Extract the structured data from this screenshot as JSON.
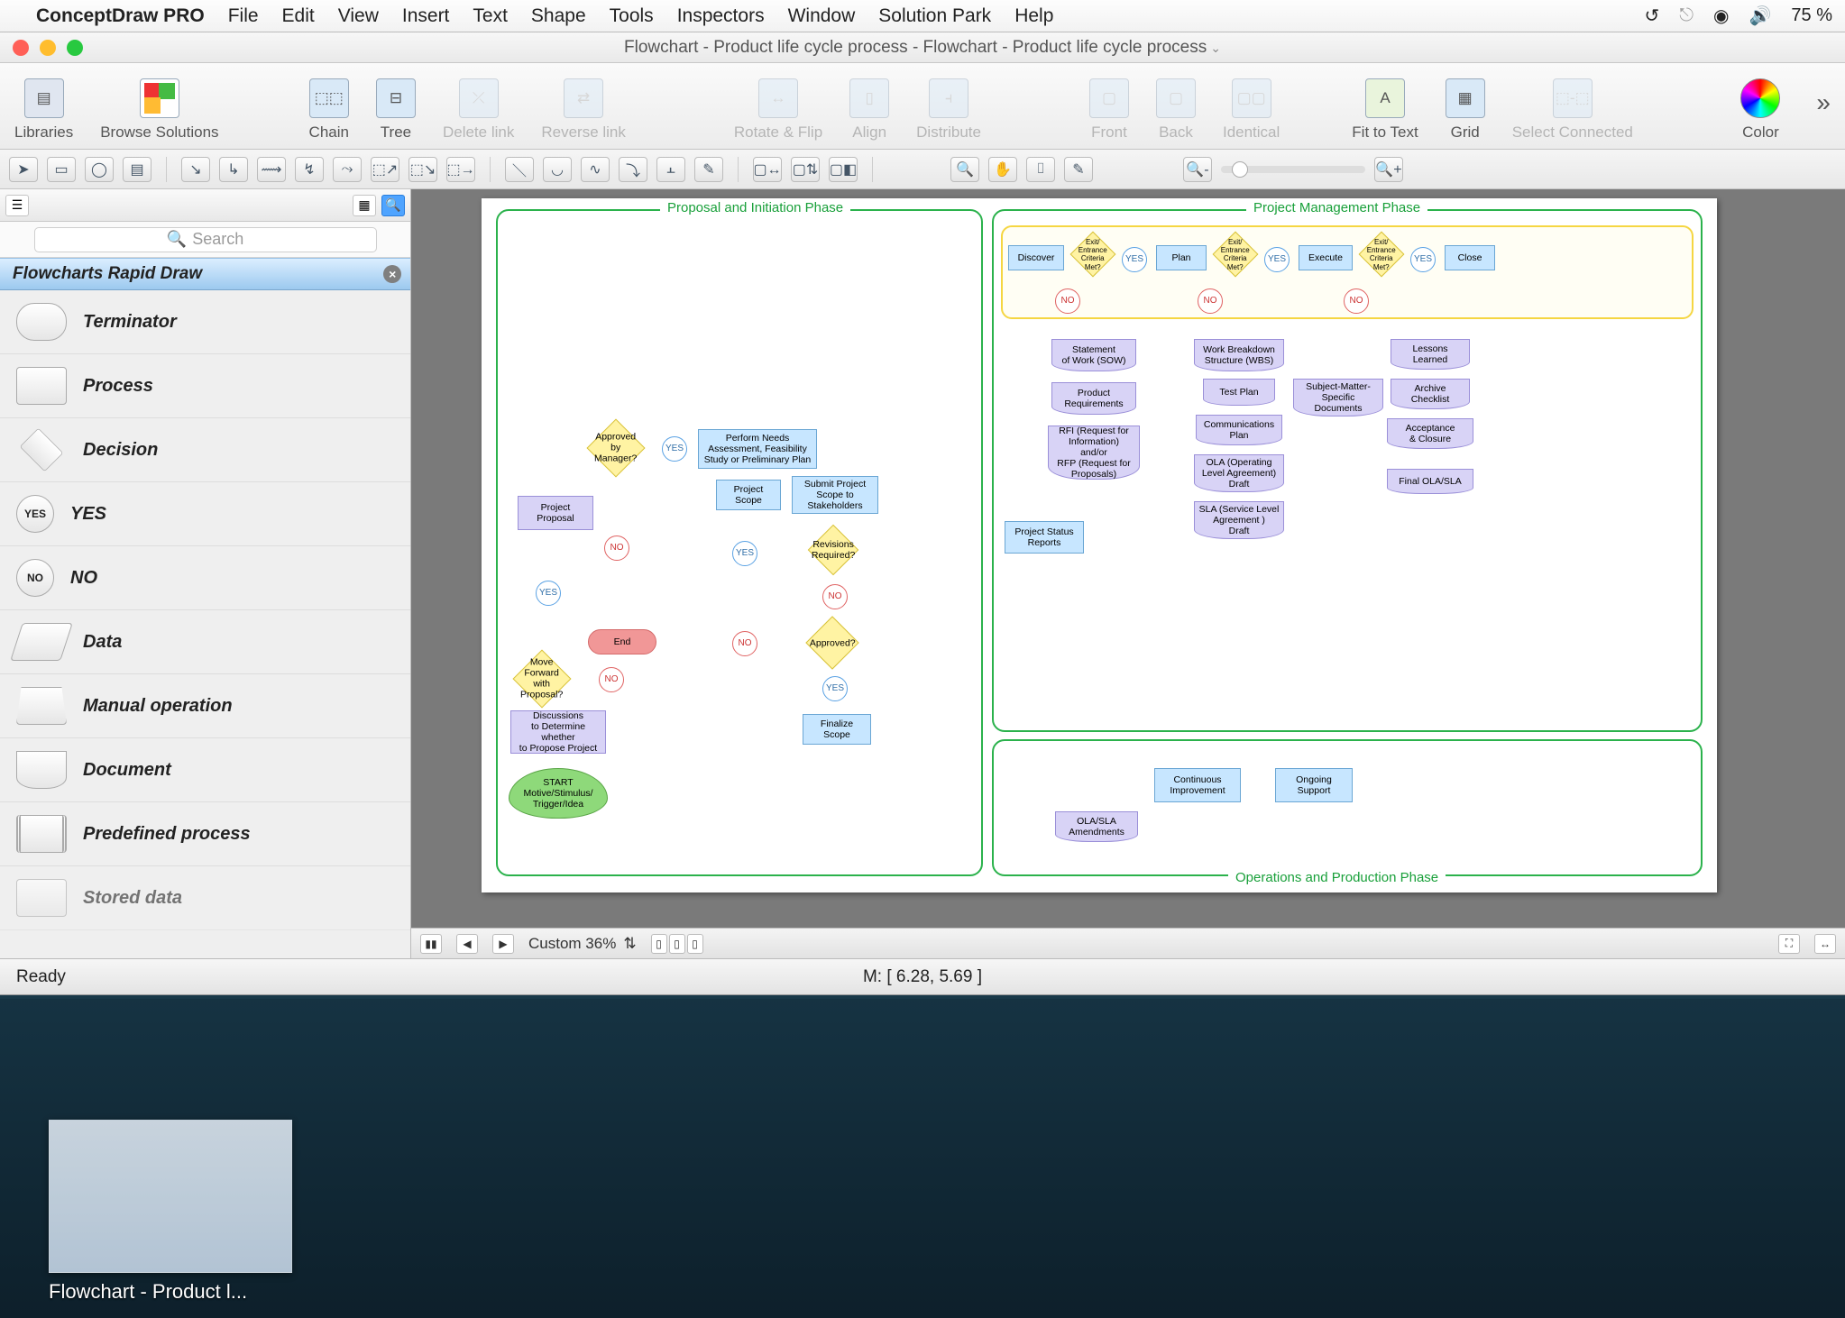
{
  "mac_menu": {
    "app": "ConceptDraw PRO",
    "items": [
      "File",
      "Edit",
      "View",
      "Insert",
      "Text",
      "Shape",
      "Tools",
      "Inspectors",
      "Window",
      "Solution Park",
      "Help"
    ],
    "battery": "75 %"
  },
  "window": {
    "title": "Flowchart - Product life cycle process - Flowchart - Product life cycle process"
  },
  "toolbar": {
    "libraries": "Libraries",
    "browse": "Browse Solutions",
    "chain": "Chain",
    "tree": "Tree",
    "delete_link": "Delete link",
    "reverse_link": "Reverse link",
    "rotate_flip": "Rotate & Flip",
    "align": "Align",
    "distribute": "Distribute",
    "front": "Front",
    "back": "Back",
    "identical": "Identical",
    "fit": "Fit to Text",
    "grid": "Grid",
    "select_conn": "Select Connected",
    "color": "Color"
  },
  "sidebar": {
    "search_placeholder": "Search",
    "lib_title": "Flowcharts Rapid Draw",
    "items": [
      {
        "label": "Terminator"
      },
      {
        "label": "Process"
      },
      {
        "label": "Decision"
      },
      {
        "label": "YES"
      },
      {
        "label": "NO"
      },
      {
        "label": "Data"
      },
      {
        "label": "Manual operation"
      },
      {
        "label": "Document"
      },
      {
        "label": "Predefined process"
      },
      {
        "label": "Stored data"
      }
    ]
  },
  "canvas": {
    "phase1": "Proposal and Initiation Phase",
    "phase2": "Project Management Phase",
    "phase3": "Operations and Production Phase",
    "nodes": {
      "start": "START\nMotive/Stimulus/\nTrigger/Idea",
      "discuss": "Discussions\nto Determine whether\nto Propose Project",
      "move_fwd": "Move Forward\nwith Proposal?",
      "proposal": "Project\nProposal",
      "approved_mgr": "Approved by\nManager?",
      "perform": "Perform Needs\nAssessment, Feasibility\nStudy or Preliminary Plan",
      "scope": "Project\nScope",
      "submit_scope": "Submit Project\nScope to\nStakeholders",
      "revisions": "Revisions\nRequired?",
      "approved": "Approved?",
      "finalize": "Finalize\nScope",
      "end": "End",
      "discover": "Discover",
      "plan": "Plan",
      "execute": "Execute",
      "close": "Close",
      "exit_crit": "Exit/\nEntrance\nCriteria\nMet?",
      "sow": "Statement\nof Work (SOW)",
      "prodreq": "Product\nRequirements",
      "rfi": "RFI (Request for\nInformation)\nand/or\nRFP (Request for\nProposals)",
      "status": "Project Status\nReports",
      "wbs": "Work Breakdown\nStructure (WBS)",
      "testplan": "Test Plan",
      "comm": "Communications\nPlan",
      "ola": "OLA (Operating\nLevel Agreement)\nDraft",
      "sla": "SLA (Service Level\nAgreement )\nDraft",
      "sme": "Subject-Matter-\nSpecific\nDocuments",
      "lessons": "Lessons\nLearned",
      "archive": "Archive\nChecklist",
      "accept": "Acceptance\n& Closure",
      "finalola": "Final OLA/SLA",
      "cont_imp": "Continuous\nImprovement",
      "ongoing": "Ongoing\nSupport",
      "amend": "OLA/SLA\nAmendments"
    },
    "yes": "YES",
    "no": "NO"
  },
  "bottombar": {
    "zoom_label": "Custom 36%"
  },
  "status": {
    "ready": "Ready",
    "coords": "M: [ 6.28, 5.69 ]"
  },
  "dock": {
    "thumb_label": "Flowchart - Product l..."
  }
}
